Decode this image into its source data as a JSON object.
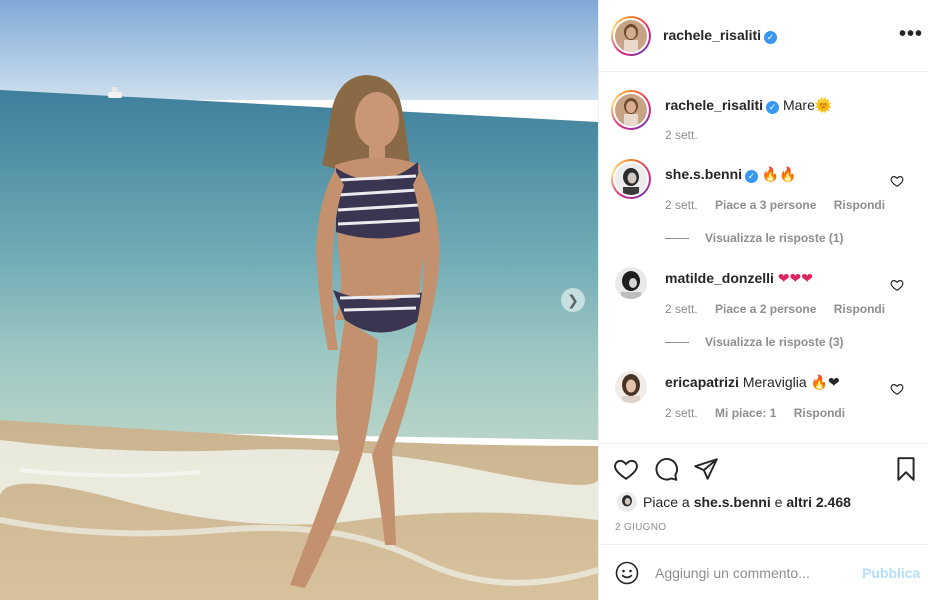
{
  "post": {
    "author": "rachele_risaliti",
    "caption": "Mare🌞",
    "caption_age": "2 sett."
  },
  "comments": [
    {
      "user": "she.s.benni",
      "verified": true,
      "text": "🔥🔥",
      "age": "2 sett.",
      "likes": "Piace a 3 persone",
      "reply": "Rispondi",
      "view_replies": "Visualizza le risposte (1)"
    },
    {
      "user": "matilde_donzelli",
      "verified": false,
      "text": "❤❤❤",
      "age": "2 sett.",
      "likes": "Piace a 2 persone",
      "reply": "Rispondi",
      "view_replies": "Visualizza le risposte (3)"
    },
    {
      "user": "ericapatrizi",
      "verified": false,
      "text": "Meraviglia 🔥❤",
      "age": "2 sett.",
      "likes": "Mi piace: 1",
      "reply": "Rispondi"
    }
  ],
  "likes_summary": {
    "prefix": "Piace a ",
    "user": "she.s.benni",
    "middle": " e ",
    "others": "altri 2.468"
  },
  "date": "2 GIUGNO",
  "add_comment": {
    "placeholder": "Aggiungi un commento...",
    "post_label": "Pubblica"
  },
  "icons": {
    "more": "more-options-icon",
    "verified": "verified-badge-icon",
    "next": "chevron-right-icon",
    "like": "heart-icon",
    "comment": "comment-bubble-icon",
    "share": "paper-plane-icon",
    "save": "bookmark-icon",
    "emoji": "smiley-icon"
  },
  "colors": {
    "verified": "#3897f0",
    "link_disabled": "#b2dffc",
    "muted": "#8e8e8e",
    "text": "#262626"
  }
}
